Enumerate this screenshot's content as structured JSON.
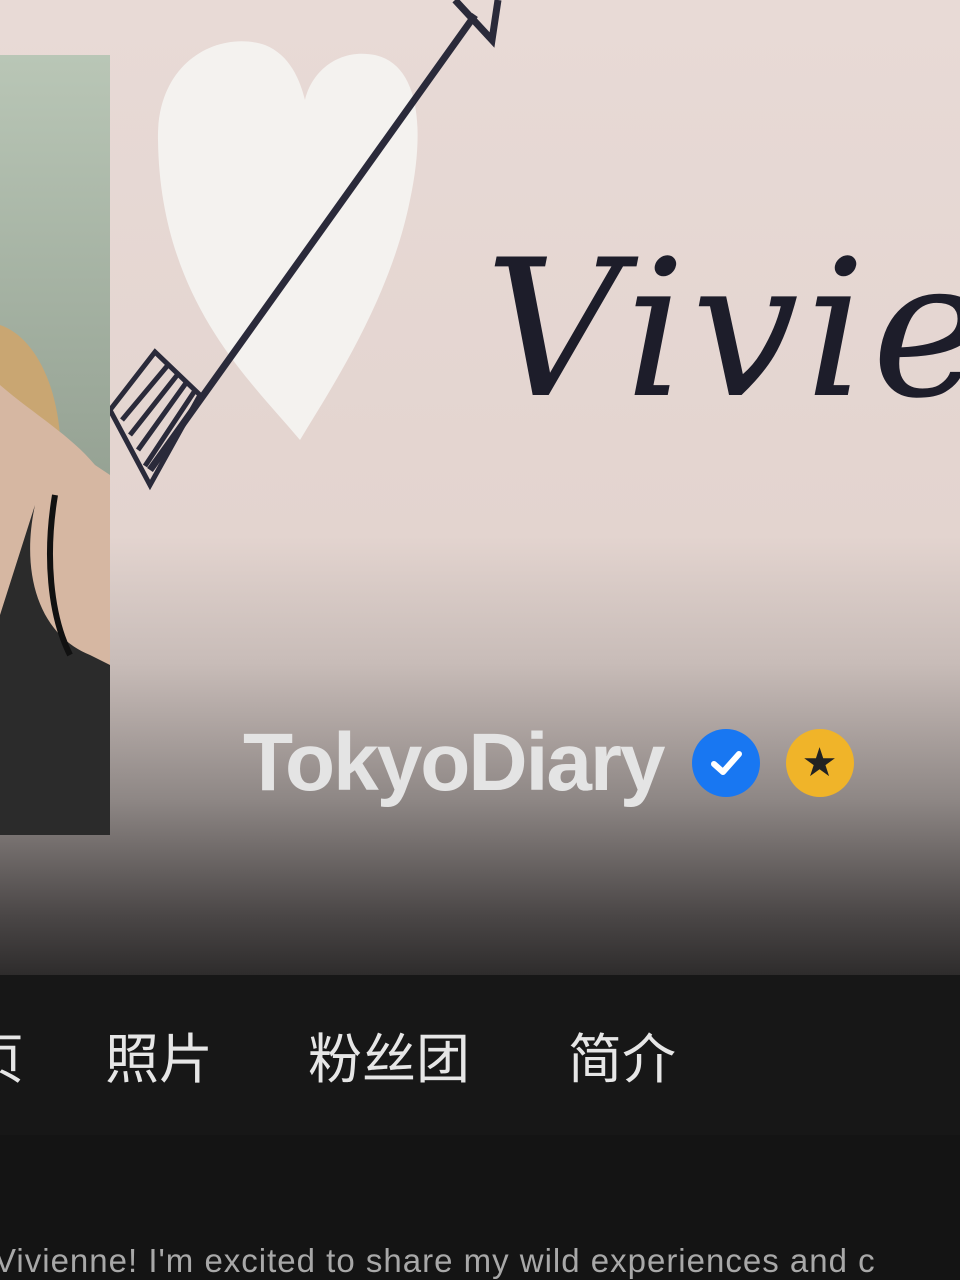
{
  "profile": {
    "name": "TokyoDiary",
    "cover_script_text": "Vivienn",
    "verified_icon": "check-circle-icon",
    "star_icon": "star-icon"
  },
  "tabs": [
    {
      "label": "页"
    },
    {
      "label": "照片"
    },
    {
      "label": "粉丝团"
    },
    {
      "label": "简介"
    }
  ],
  "bio": "Vivienne! I'm excited to share my wild experiences and c",
  "colors": {
    "cover_bg": "#e8dad6",
    "verified_badge": "#1877f2",
    "star_badge": "#f0b429",
    "tabbar_bg": "#171717"
  }
}
